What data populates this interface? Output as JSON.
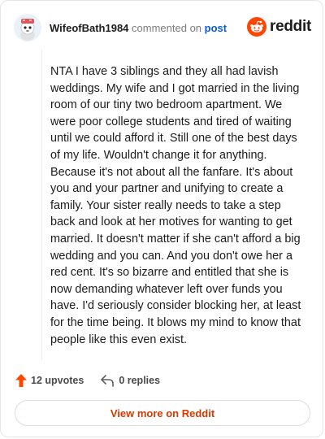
{
  "comment": {
    "username": "WifeofBath1984",
    "action_text": "commented on",
    "post_link": "post",
    "body": "NTA I have 3 siblings and they all had lavish weddings. My wife and I got married in the living room of our tiny two bedroom apartment. We were poor college students and tired of waiting until we could afford it. Still one of the best days of my life. Wouldn't change it for anything. Because it's not about all the fanfare. It's about you and your partner and unifying to create a family. Your sister really needs to take a step back and look at her motives for wanting to get married. It doesn't matter if she can't afford a big wedding and you can. And you don't owe her a red cent. It's so bizarre and entitled that she is now demanding whatever left over funds you have. I'd seriously consider blocking her, at least for the time being. It blows my mind to know that people like this even exist.",
    "upvotes": "12 upvotes",
    "replies": "0 replies"
  },
  "brand": {
    "wordmark": "reddit",
    "color": "#ff4500"
  },
  "cta": {
    "label": "View more on Reddit",
    "color": "#d93900"
  },
  "icons": [
    "avatar-icon",
    "reddit-logo-icon",
    "upvote-arrow-icon",
    "reply-arrow-icon"
  ]
}
